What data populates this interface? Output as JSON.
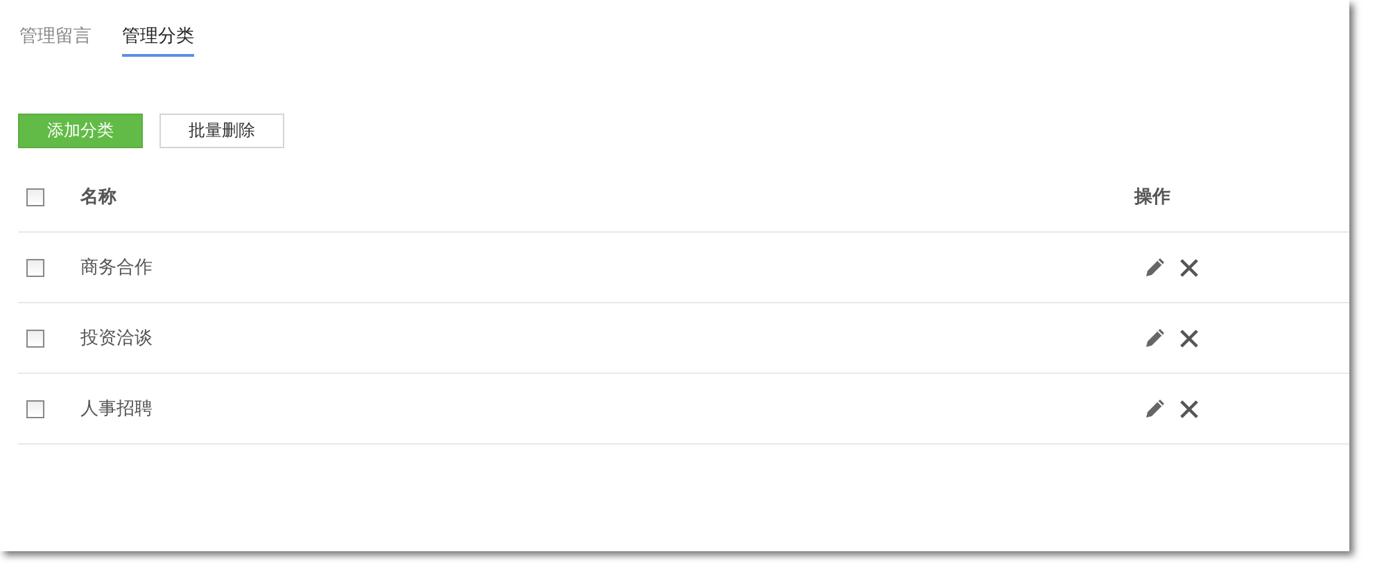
{
  "tabs": [
    {
      "label": "管理留言",
      "selected": false
    },
    {
      "label": "管理分类",
      "selected": true
    }
  ],
  "toolbar": {
    "buttons": [
      {
        "label": "添加分类",
        "kind": "primary"
      },
      {
        "label": "批量删除",
        "kind": "default"
      }
    ]
  },
  "table": {
    "columns": [
      {
        "label": "名称",
        "checked": false
      },
      {
        "label": "操作"
      }
    ],
    "rows": [
      {
        "name": "商务合作",
        "checked": false
      },
      {
        "name": "投资洽谈",
        "checked": false
      },
      {
        "name": "人事招聘",
        "checked": false
      }
    ]
  }
}
